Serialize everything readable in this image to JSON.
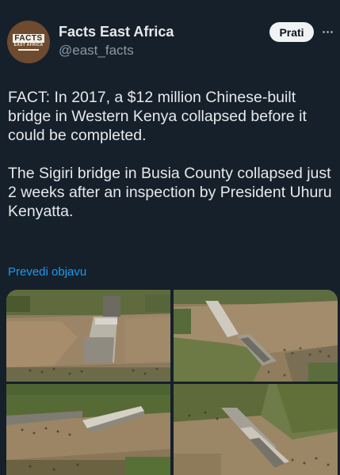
{
  "account": {
    "avatar_logo_main": "FACTS",
    "avatar_logo_sub": "EAST AFRICA",
    "name": "Facts East Africa",
    "handle": "@east_facts"
  },
  "actions": {
    "follow_label": "Prati"
  },
  "tweet": {
    "paragraphs": [
      "FACT: In 2017, a $12 million Chinese-built bridge in Western Kenya collapsed before it could be completed.",
      "The Sigiri bridge in Busia County collapsed just 2 weeks after an inspection by President Uhuru Kenyatta."
    ],
    "translate_label": "Prevedi objavu"
  },
  "colors": {
    "background": "#15202b",
    "text_primary": "#e7e9ea",
    "text_secondary": "#8b98a5",
    "link": "#1d9bf0",
    "follow_bg": "#eff3f4"
  }
}
